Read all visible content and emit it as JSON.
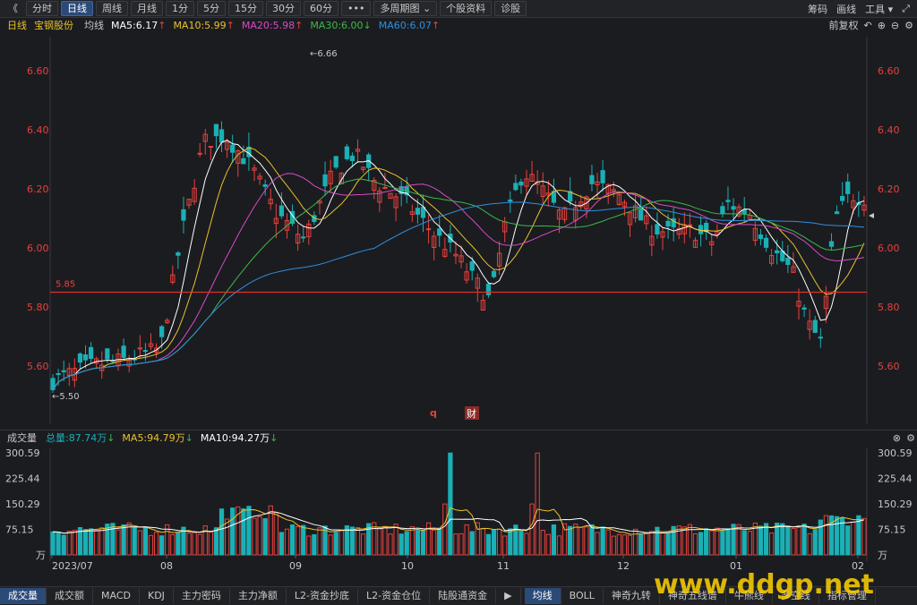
{
  "toolbar": {
    "back": "《",
    "buttons": [
      "分时",
      "日线",
      "周线",
      "月线",
      "1分",
      "5分",
      "15分",
      "30分",
      "60分",
      "•••",
      "多周期图 ⌄",
      "个股资料",
      "诊股"
    ],
    "active_index": 1,
    "right": [
      "筹码",
      "画线",
      "工具 ▾"
    ]
  },
  "info": {
    "period": "日线",
    "stock": "宝钢股份",
    "ma_label": "均线",
    "ma5": "MA5:6.17",
    "ma10": "MA10:5.99",
    "ma20": "MA20:5.98",
    "ma30": "MA30:6.00",
    "ma60": "MA60:6.07",
    "adjust": "前复权"
  },
  "colors": {
    "up": "#e8413c",
    "down": "#1ab0b5",
    "ma5": "#ffffff",
    "ma10": "#e8c22e",
    "ma20": "#d64bc4",
    "ma30": "#3cb84a",
    "ma60": "#2f8fe0",
    "support": "#d9332c"
  },
  "chart": {
    "y_ticks": [
      "6.60",
      "6.40",
      "6.20",
      "6.00",
      "5.80",
      "5.60"
    ],
    "y_values": [
      6.6,
      6.4,
      6.2,
      6.0,
      5.8,
      5.6
    ],
    "support_label": "5.85",
    "support_value": 5.85,
    "high_label": "6.66",
    "low_label": "5.50",
    "markers": [
      "q",
      "财"
    ]
  },
  "volume": {
    "title": "成交量",
    "total": "总量:87.74万",
    "ma5": "MA5:94.79万",
    "ma10": "MA10:94.27万",
    "y_ticks": [
      "300.59",
      "225.44",
      "150.29",
      "75.15",
      "万"
    ],
    "y_values": [
      300.59,
      225.44,
      150.29,
      75.15,
      0
    ]
  },
  "x_axis": {
    "labels": [
      "2023/07",
      "08",
      "09",
      "10",
      "11",
      "12",
      "01",
      "02"
    ]
  },
  "bottom_tabs": {
    "left": [
      "成交量",
      "成交额",
      "MACD",
      "KDJ",
      "主力密码",
      "主力净额",
      "L2-资金抄底",
      "L2-资金仓位",
      "陆股通资金"
    ],
    "right": [
      "均线",
      "BOLL",
      "神奇九转",
      "神奇五线谱",
      "牛熊线",
      "多空线",
      "指标管理"
    ]
  },
  "watermark": "www.ddgp.net"
}
